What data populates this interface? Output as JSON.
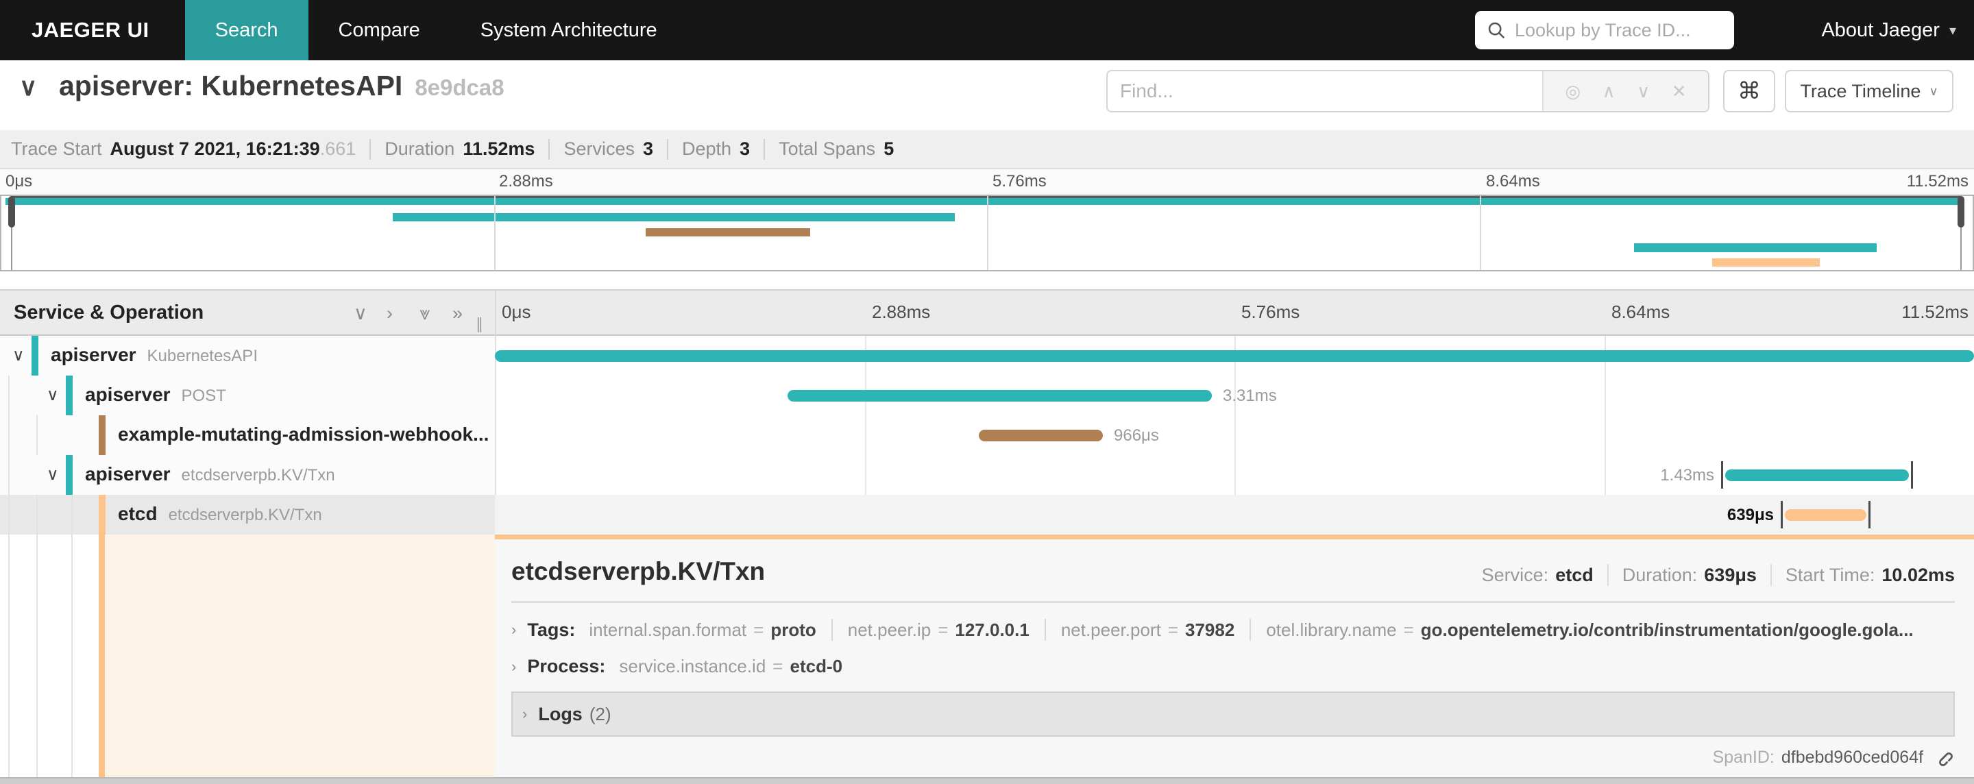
{
  "nav": {
    "brand": "JAEGER UI",
    "tabs": [
      {
        "label": "Search",
        "active": true
      },
      {
        "label": "Compare",
        "active": false
      },
      {
        "label": "System Architecture",
        "active": false
      }
    ],
    "lookup_placeholder": "Lookup by Trace ID...",
    "about_label": "About Jaeger"
  },
  "trace_header": {
    "title": "apiserver: KubernetesAPI",
    "trace_id": "8e9dca8",
    "find_placeholder": "Find...",
    "find_icons": [
      "target-icon",
      "prev-icon",
      "next-icon",
      "clear-icon"
    ],
    "keyboard_shortcut_icon": "⌘",
    "view_dropdown_label": "Trace Timeline"
  },
  "summary": {
    "trace_start_label": "Trace Start",
    "trace_start_value": "August 7 2021, 16:21:39",
    "trace_start_millis": ".661",
    "duration_label": "Duration",
    "duration_value": "11.52ms",
    "services_label": "Services",
    "services_value": "3",
    "depth_label": "Depth",
    "depth_value": "3",
    "total_spans_label": "Total Spans",
    "total_spans_value": "5"
  },
  "timeline": {
    "ticks": [
      "0μs",
      "2.88ms",
      "5.76ms",
      "8.64ms",
      "11.52ms"
    ],
    "header_label": "Service & Operation",
    "header_icons": [
      "collapse-one-icon",
      "expand-one-icon",
      "collapse-all-icon",
      "expand-all-icon"
    ],
    "header_icon_glyphs": [
      "∨",
      "›",
      "⩔",
      "»"
    ]
  },
  "spans": [
    {
      "service": "apiserver",
      "operation": "KubernetesAPI",
      "depth": 0,
      "has_children": true,
      "color": "#2db5b5",
      "start_pct": 0,
      "width_pct": 100,
      "duration_label": "",
      "label_side": "none",
      "edge_ticks": false,
      "selected": false
    },
    {
      "service": "apiserver",
      "operation": "POST",
      "depth": 1,
      "has_children": true,
      "color": "#2db5b5",
      "start_pct": 19.8,
      "width_pct": 28.7,
      "duration_label": "3.31ms",
      "label_side": "after",
      "edge_ticks": false,
      "selected": false
    },
    {
      "service": "example-mutating-admission-webhook...",
      "operation": "",
      "depth": 2,
      "has_children": false,
      "color": "#b08052",
      "start_pct": 32.7,
      "width_pct": 8.4,
      "duration_label": "966μs",
      "label_side": "after",
      "edge_ticks": false,
      "selected": false
    },
    {
      "service": "apiserver",
      "operation": "etcdserverpb.KV/Txn",
      "depth": 1,
      "has_children": true,
      "color": "#2db5b5",
      "start_pct": 83.2,
      "width_pct": 12.4,
      "duration_label": "1.43ms",
      "label_side": "before",
      "edge_ticks": true,
      "selected": false
    },
    {
      "service": "etcd",
      "operation": "etcdserverpb.KV/Txn",
      "depth": 2,
      "has_children": false,
      "color": "#fcc48a",
      "start_pct": 87.2,
      "width_pct": 5.5,
      "duration_label": "639μs",
      "label_side": "before",
      "edge_ticks": true,
      "selected": true
    }
  ],
  "detail": {
    "title": "etcdserverpb.KV/Txn",
    "service_label": "Service:",
    "service_value": "etcd",
    "duration_label": "Duration:",
    "duration_value": "639μs",
    "start_time_label": "Start Time:",
    "start_time_value": "10.02ms",
    "tags_label": "Tags:",
    "tags": [
      {
        "key": "internal.span.format",
        "value": "proto"
      },
      {
        "key": "net.peer.ip",
        "value": "127.0.0.1"
      },
      {
        "key": "net.peer.port",
        "value": "37982"
      },
      {
        "key": "otel.library.name",
        "value": "go.opentelemetry.io/contrib/instrumentation/google.gola..."
      }
    ],
    "process_label": "Process:",
    "process_key": "service.instance.id",
    "process_value": "etcd-0",
    "logs_label": "Logs",
    "logs_count": "(2)",
    "spanid_label": "SpanID:",
    "spanid_value": "dfbebd960ced064f"
  },
  "colors": {
    "accent_teal": "#2a9c9c",
    "span_teal": "#2db5b5",
    "span_brown": "#b08052",
    "span_orange": "#fcc48a",
    "selected_row_bg": "#e8e8e8",
    "detail_left_bg": "#fdf3e6"
  }
}
